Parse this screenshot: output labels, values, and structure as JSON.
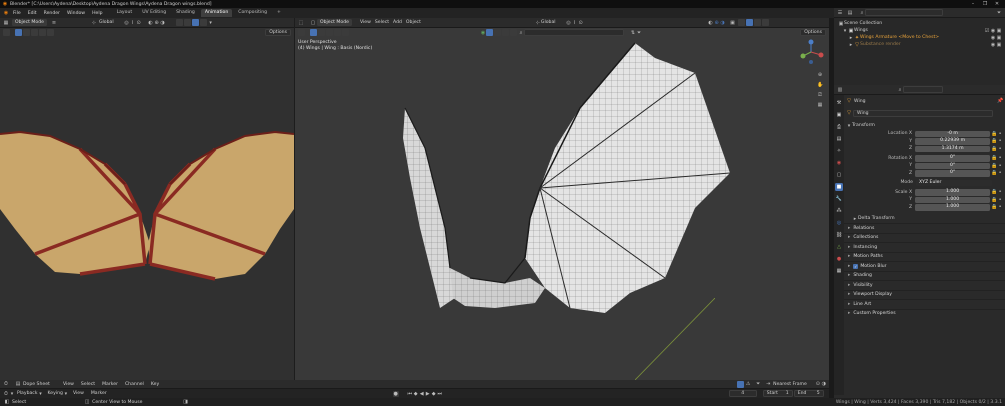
{
  "window": {
    "title": "Blender* [C:\\Users\\Aydena\\Desktop\\Aydena Dragon Wings\\Aydena Dragon wings.blend]",
    "controls": [
      "–",
      "❐",
      "✕"
    ]
  },
  "menubar": {
    "items": [
      "File",
      "Edit",
      "Render",
      "Window",
      "Help"
    ],
    "workspaces": [
      "Layout",
      "UV Editing",
      "Shading",
      "Animation",
      "Compositing"
    ],
    "active_workspace": "Animation",
    "add_tab": "+",
    "scene_label": "Scene",
    "view_layer_label": "ViewLayer"
  },
  "uv_editor": {
    "mode": "Object Mode",
    "orientation": "Global",
    "options_label": "Options"
  },
  "viewport": {
    "mode": "Object Mode",
    "menus": [
      "View",
      "Select",
      "Add",
      "Object"
    ],
    "orientation": "Global",
    "options_label": "Options",
    "overlay_title": "User Perspective",
    "overlay_sub": "(4) Wings | Wing : Basis (Nordic)"
  },
  "outliner": {
    "items": [
      {
        "label": "Scene Collection"
      },
      {
        "label": "Wings"
      },
      {
        "label": "Wings Armature <Move to Chest>"
      },
      {
        "label": "Substance render"
      }
    ]
  },
  "properties": {
    "object_name": "Wing",
    "object_field": "Wing",
    "transform_header": "Transform",
    "location": {
      "label": "Location X",
      "x": "-0 m",
      "y": "0.22939 m",
      "z": "1.3174 m"
    },
    "rotation": {
      "label": "Rotation X",
      "x": "0°",
      "y": "0°",
      "z": "0°"
    },
    "mode": {
      "label": "Mode",
      "value": "XYZ Euler"
    },
    "scale": {
      "label": "Scale X",
      "x": "1.000",
      "y": "1.000",
      "z": "1.000"
    },
    "axis_y": "Y",
    "axis_z": "Z",
    "panels": [
      "Delta Transform",
      "Relations",
      "Collections",
      "Instancing",
      "Motion Paths",
      "Motion Blur",
      "Shading",
      "Visibility",
      "Viewport Display",
      "Line Art",
      "Custom Properties"
    ]
  },
  "dopesheet": {
    "mode": "Dope Sheet",
    "menus": [
      "View",
      "Select",
      "Marker",
      "Channel",
      "Key"
    ],
    "snap": "Nearest Frame"
  },
  "timeline": {
    "menus": [
      "Playback",
      "Keying",
      "View",
      "Marker"
    ],
    "current_frame": "4",
    "start_label": "Start",
    "start": "1",
    "end_label": "End",
    "end": "5"
  },
  "status": {
    "left": "Select",
    "middle": "Center View to Mouse",
    "right": "Wings | Wing | Verts 3,424 | Faces 3,390 | Tris 7,182 | Objects 0/2 | 3.3.1"
  },
  "colors": {
    "accent": "#4772b3",
    "wing_membrane": "#c9a66b",
    "wing_bone": "#8a2a22",
    "selected_orange": "#e8a33b"
  }
}
